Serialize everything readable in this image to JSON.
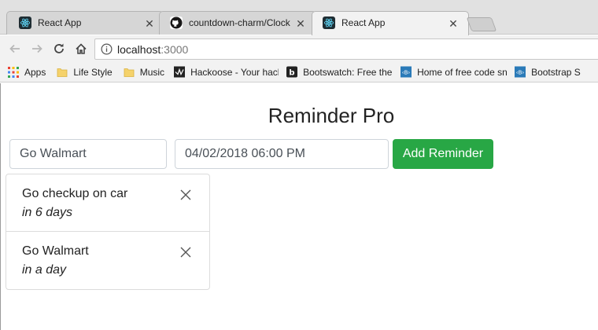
{
  "browser": {
    "tabs": [
      {
        "title": "React App",
        "icon": "react-icon",
        "active": false
      },
      {
        "title": "countdown-charm/Clock",
        "icon": "github-icon",
        "active": false
      },
      {
        "title": "React App",
        "icon": "react-icon",
        "active": true
      }
    ],
    "url": {
      "host": "localhost",
      "port": ":3000"
    },
    "bookmarks": [
      {
        "label": "Apps",
        "icon": "apps-grid-icon"
      },
      {
        "label": "Life Style",
        "icon": "folder-icon"
      },
      {
        "label": "Music",
        "icon": "folder-icon"
      },
      {
        "label": "Hackoose - Your hack",
        "icon": "hackoose-icon"
      },
      {
        "label": "Bootswatch: Free the",
        "icon": "bootswatch-icon"
      },
      {
        "label": "Home of free code sn",
        "icon": "bootsnipp-icon"
      },
      {
        "label": "Bootstrap S",
        "icon": "bootsnipp-icon"
      }
    ]
  },
  "app": {
    "title": "Reminder Pro",
    "reminder_input_value": "Go Walmart",
    "date_input_value": "04/02/2018 06:00 PM",
    "add_button_label": "Add Reminder",
    "reminders": [
      {
        "text": "Go checkup on car",
        "due": "in 6 days"
      },
      {
        "text": "Go Walmart",
        "due": "in a day"
      }
    ],
    "accent_color": "#28a745"
  }
}
